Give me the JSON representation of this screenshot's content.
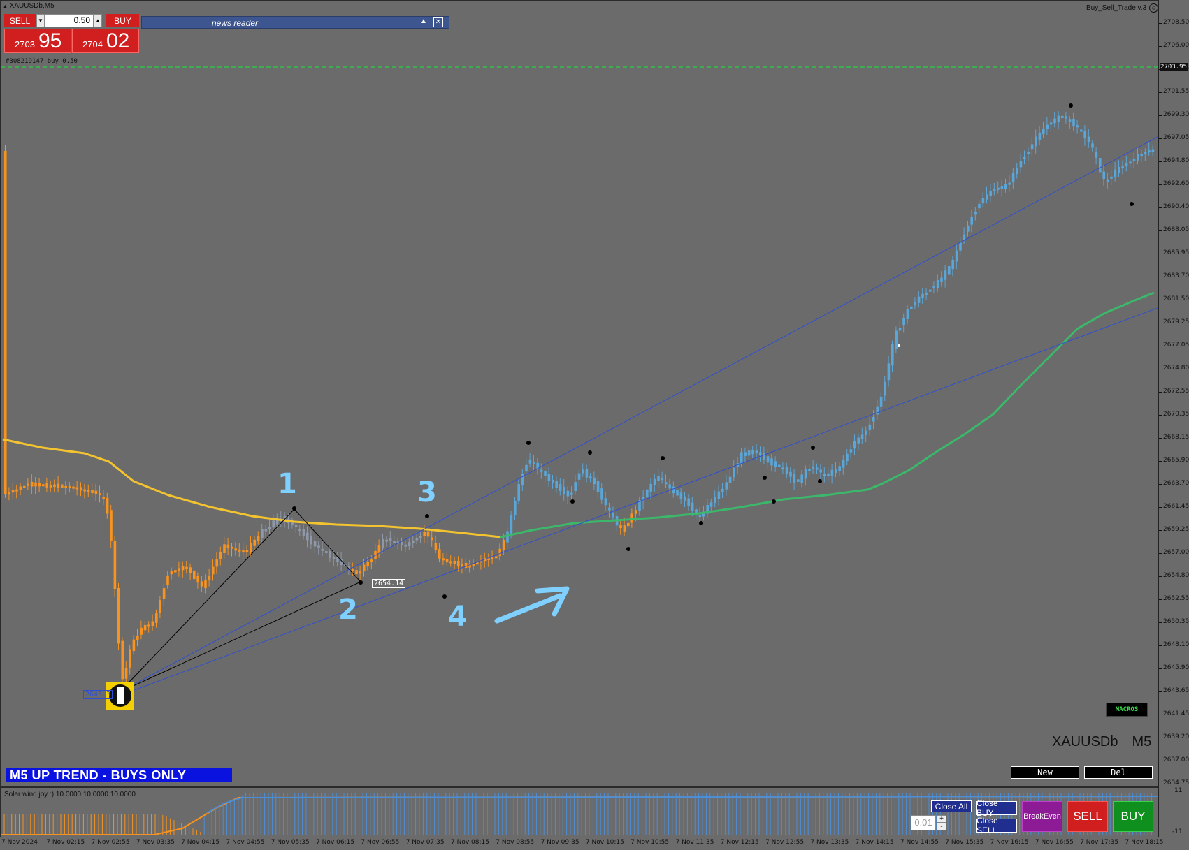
{
  "window": {
    "symbol_title": "XAUUSDb,M5",
    "ea_title": "Buy_Sell_Trade v.3"
  },
  "trade_panel": {
    "sell_label": "SELL",
    "buy_label": "BUY",
    "lot_value": "0.50",
    "sell_price_big": "2703",
    "sell_price_small": "95",
    "buy_price_big": "2704",
    "buy_price_small": "02"
  },
  "news_reader": {
    "title": "news reader"
  },
  "position_label": "#308219147 buy 0.50",
  "price_line_label": "2703.95",
  "price_axis": {
    "ticks": [
      "2708.50",
      "2706.00",
      "2703.95",
      "2701.55",
      "2699.30",
      "2697.05",
      "2694.80",
      "2692.60",
      "2690.40",
      "2688.05",
      "2685.95",
      "2683.70",
      "2681.50",
      "2679.25",
      "2677.05",
      "2674.80",
      "2672.55",
      "2670.35",
      "2668.15",
      "2665.90",
      "2663.70",
      "2661.45",
      "2659.25",
      "2657.00",
      "2654.80",
      "2652.55",
      "2650.35",
      "2648.10",
      "2645.90",
      "2643.65",
      "2641.45",
      "2639.20",
      "2637.00",
      "2634.75"
    ]
  },
  "annotations": {
    "num1": "1",
    "num2": "2",
    "num3": "3",
    "num4": "4",
    "price_2654": "2654.14",
    "low_box": "2645.3"
  },
  "trend_label": "M5  UP TREND - BUYS ONLY",
  "macros_label": "MACROS",
  "symbol_watermark": {
    "symbol": "XAUUSDb",
    "tf": "M5"
  },
  "buttons": {
    "new": "New",
    "del": "Del",
    "close_all": "Close All",
    "close_buy": "Close BUY",
    "close_sell": "Close SELL",
    "breakeven": "BreakEven",
    "sell": "SELL",
    "buy": "BUY",
    "lot_small": "0.01",
    "plus": "+",
    "minus": "-"
  },
  "indicator": {
    "title": "Solar wind joy :) 10.0000 10.0000 10.0000",
    "scale_top": "11",
    "scale_bottom": "-11"
  },
  "time_axis": {
    "labels": [
      "7 Nov 2024",
      "7 Nov 02:15",
      "7 Nov 02:55",
      "7 Nov 03:35",
      "7 Nov 04:15",
      "7 Nov 04:55",
      "7 Nov 05:35",
      "7 Nov 06:15",
      "7 Nov 06:55",
      "7 Nov 07:35",
      "7 Nov 08:15",
      "7 Nov 08:55",
      "7 Nov 09:35",
      "7 Nov 10:15",
      "7 Nov 10:55",
      "7 Nov 11:35",
      "7 Nov 12:15",
      "7 Nov 12:55",
      "7 Nov 13:35",
      "7 Nov 14:15",
      "7 Nov 14:55",
      "7 Nov 15:35",
      "7 Nov 16:15",
      "7 Nov 16:55",
      "7 Nov 17:35",
      "7 Nov 18:15"
    ]
  },
  "colors": {
    "bg": "#6b6b6b",
    "bear_candle": "#f7931e",
    "bull_candle": "#5aa6d8",
    "neutral_candle": "#8e98a8",
    "ma_yellow": "#f4c430",
    "ma_green": "#3bb86a",
    "trendline": "#2f4fd0",
    "annotation": "#7fd0ff"
  }
}
